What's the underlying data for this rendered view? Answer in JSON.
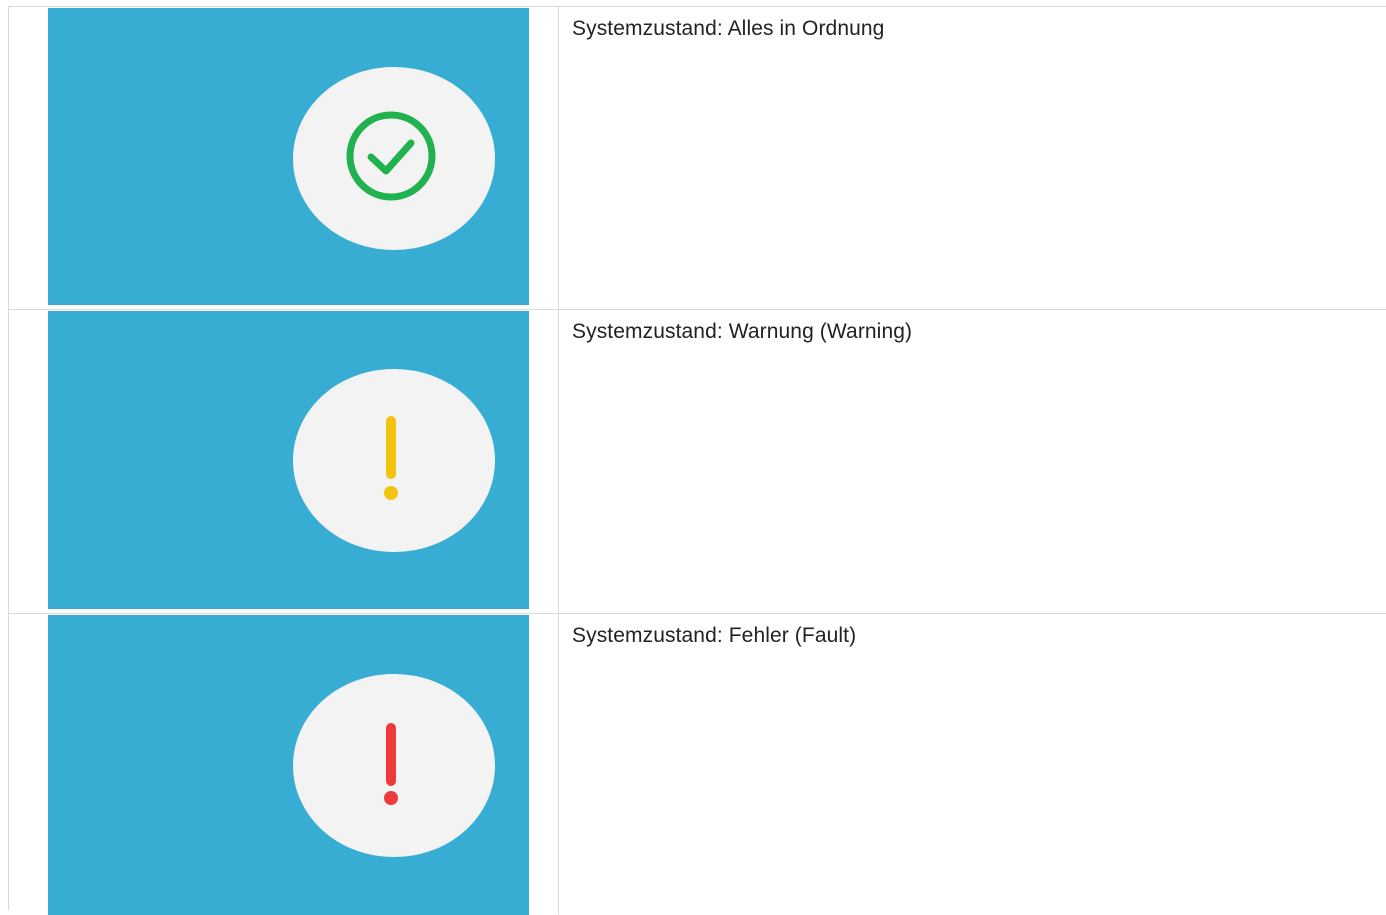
{
  "rows": [
    {
      "label": "Systemzustand: Alles in Ordnung",
      "icon": "check-circle-icon",
      "icon_color": "#1fb24f",
      "panel_color": "#38add3"
    },
    {
      "label": "Systemzustand: Warnung (Warning)",
      "icon": "exclamation-icon",
      "icon_color": "#f2c40f",
      "panel_color": "#38add3"
    },
    {
      "label": "Systemzustand: Fehler (Fault)",
      "icon": "exclamation-icon",
      "icon_color": "#ee3a3a",
      "panel_color": "#38add3"
    }
  ]
}
